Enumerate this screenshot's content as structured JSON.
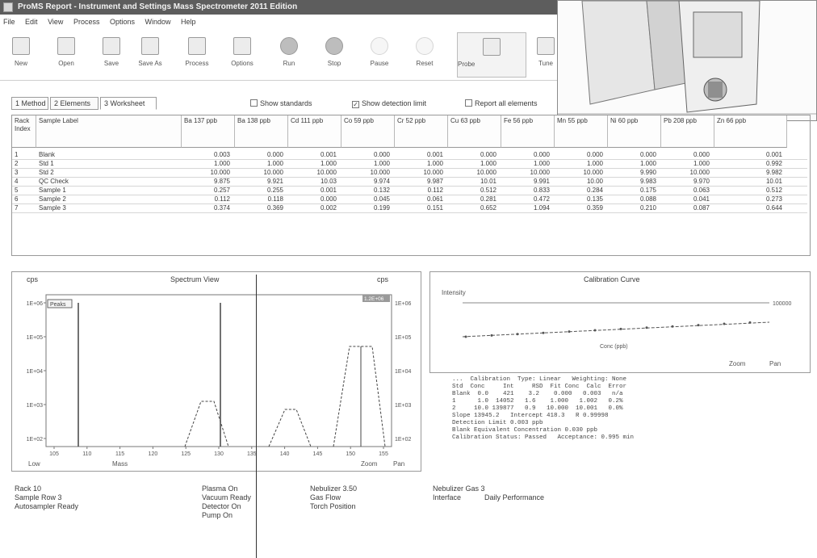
{
  "window": {
    "title": "ProMS Report - Instrument and Settings Mass Spectrometer 2011 Edition"
  },
  "menu": [
    "File",
    "Edit",
    "View",
    "Process",
    "Options",
    "Window",
    "Help"
  ],
  "toolbar": [
    {
      "label": "New",
      "icon": "new-icon"
    },
    {
      "label": "Open",
      "icon": "open-icon"
    },
    {
      "label": "Save",
      "icon": "save-icon"
    },
    {
      "label": "Save As",
      "icon": "save-as-icon"
    },
    {
      "label": "Process",
      "icon": "process-icon"
    },
    {
      "label": "Options",
      "icon": "options-icon"
    },
    {
      "label": "Run",
      "icon": "run-icon"
    },
    {
      "label": "Stop",
      "icon": "stop-icon"
    },
    {
      "label": "Pause",
      "icon": "pause-icon"
    },
    {
      "label": "Reset",
      "icon": "reset-icon"
    },
    {
      "label": "Probe",
      "icon": "probe-icon"
    },
    {
      "label": "Tune",
      "icon": "tune-icon"
    }
  ],
  "tabs": [
    "1 Method",
    "2 Elements",
    "3 Worksheet"
  ],
  "checks": [
    {
      "label": "Show standards",
      "checked": false
    },
    {
      "label": "Show detection limit",
      "checked": true
    },
    {
      "label": "Report all elements",
      "checked": false
    }
  ],
  "table": {
    "columns": [
      "Rack Index",
      "Sample Label",
      "Ba 137 ppb",
      "Ba 138 ppb",
      "Cd 111 ppb",
      "Co 59 ppb",
      "Cr 52 ppb",
      "Cu 63 ppb",
      "Fe 56 ppb",
      "Mn 55 ppb",
      "Ni 60 ppb",
      "Pb 208 ppb",
      "Zn 66 ppb"
    ],
    "rows": [
      [
        "1",
        "Blank",
        "0.003",
        "0.000",
        "0.001",
        "0.000",
        "0.001",
        "0.000",
        "0.000",
        "0.000",
        "0.000",
        "0.000",
        "0.001"
      ],
      [
        "2",
        "Std 1",
        "1.000",
        "1.000",
        "1.000",
        "1.000",
        "1.000",
        "1.000",
        "1.000",
        "1.000",
        "1.000",
        "1.000",
        "0.992"
      ],
      [
        "3",
        "Std 2",
        "10.000",
        "10.000",
        "10.000",
        "10.000",
        "10.000",
        "10.000",
        "10.000",
        "10.000",
        "9.990",
        "10.000",
        "9.982"
      ],
      [
        "4",
        "QC Check",
        "9.875",
        "9.921",
        "10.03",
        "9.974",
        "9.987",
        "10.01",
        "9.991",
        "10.00",
        "9.983",
        "9.970",
        "10.01"
      ],
      [
        "5",
        "Sample 1",
        "0.257",
        "0.255",
        "0.001",
        "0.132",
        "0.112",
        "0.512",
        "0.833",
        "0.284",
        "0.175",
        "0.063",
        "0.512"
      ],
      [
        "6",
        "Sample 2",
        "0.112",
        "0.118",
        "0.000",
        "0.045",
        "0.061",
        "0.281",
        "0.472",
        "0.135",
        "0.088",
        "0.041",
        "0.273"
      ],
      [
        "7",
        "Sample 3",
        "0.374",
        "0.369",
        "0.002",
        "0.199",
        "0.151",
        "0.652",
        "1.094",
        "0.359",
        "0.210",
        "0.087",
        "0.644"
      ]
    ]
  },
  "spectrum": {
    "title": "Spectrum View",
    "left_label": "cps",
    "right_label": "cps",
    "legend": "Peaks",
    "badge": "1.2E+06",
    "x_ticks": [
      "105",
      "110",
      "115",
      "120",
      "125",
      "130",
      "135",
      "140",
      "145",
      "150",
      "155"
    ],
    "y_ticks": [
      "1E+06",
      "1E+05",
      "1E+04",
      "1E+03",
      "1E+02"
    ],
    "footer_left": "Low",
    "footer_mid": "Mass",
    "footer_right1": "Zoom",
    "footer_right2": "Pan"
  },
  "calibration": {
    "title": "Calibration Curve",
    "top_label": "Intensity",
    "badge": "100000",
    "x_label": "Conc (ppb)",
    "footer1": "Zoom",
    "footer2": "Pan",
    "report_lines": [
      "...  Calibration  Type: Linear   Weighting: None",
      "Std  Conc     Int     RSD  Fit Conc  Calc  Error",
      "Blank  0.0    421    3.2    0.000   0.003   n/a",
      "1      1.0  14052   1.6    1.000   1.002   0.2%",
      "2     10.0 139877   0.9   10.000  10.001   0.0%",
      "Slope 13945.2   Intercept 418.3   R 0.99998",
      "Detection Limit 0.003 ppb",
      "Blank Equivalent Concentration 0.030 ppb",
      "Calibration Status: Passed   Acceptance: 0.995 min"
    ]
  },
  "status": {
    "left": [
      "Rack  10",
      "Sample  Row 3",
      "Autosampler  Ready"
    ],
    "mid": [
      "Plasma  On",
      "Vacuum  Ready",
      "Detector  On",
      "Pump  On"
    ],
    "right": [
      "Nebulizer  3.50",
      "Gas  Flow",
      "Torch  Position"
    ],
    "far": [
      "Nebulizer  Gas  3",
      "Interface",
      "Daily Performance"
    ]
  }
}
